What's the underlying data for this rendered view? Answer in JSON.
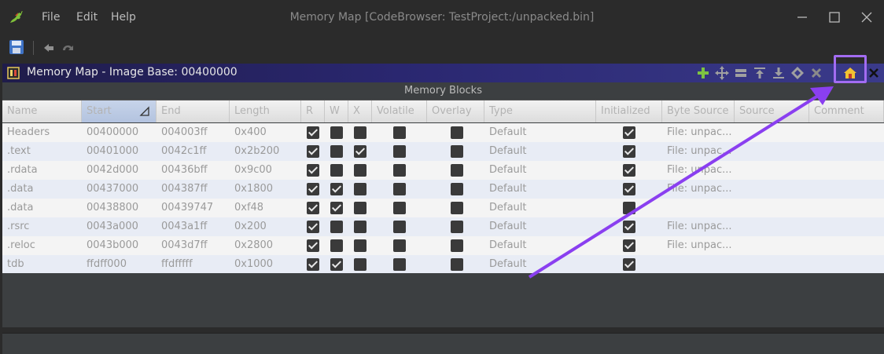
{
  "window": {
    "title": "Memory Map [CodeBrowser: TestProject:/unpacked.bin]",
    "menu": [
      "File",
      "Edit",
      "Help"
    ]
  },
  "toolbar": {
    "icons": [
      "save-icon",
      "undo-icon",
      "redo-icon"
    ]
  },
  "panel": {
    "title": "Memory Map - Image Base: 00400000",
    "actions": [
      "add-block-icon",
      "move-block-icon",
      "split-block-icon",
      "expand-up-icon",
      "expand-down-icon",
      "merge-blocks-icon",
      "delete-block-icon",
      "set-image-base-icon",
      "close-icon"
    ],
    "highlighted_action": "set-image-base-icon"
  },
  "table": {
    "title": "Memory Blocks",
    "columns": [
      "Name",
      "Start",
      "End",
      "Length",
      "R",
      "W",
      "X",
      "Volatile",
      "Overlay",
      "Type",
      "Initialized",
      "Byte Source",
      "Source",
      "Comment"
    ],
    "rows": [
      {
        "name": "Headers",
        "start": "00400000",
        "end": "004003ff",
        "length": "0x400",
        "r": true,
        "w": false,
        "x": false,
        "volatile": false,
        "overlay": false,
        "type": "Default",
        "initialized": true,
        "byte_source": "File: unpac...",
        "source": "",
        "comment": ""
      },
      {
        "name": ".text",
        "start": "00401000",
        "end": "0042c1ff",
        "length": "0x2b200",
        "r": true,
        "w": false,
        "x": true,
        "volatile": false,
        "overlay": false,
        "type": "Default",
        "initialized": true,
        "byte_source": "File: unpac...",
        "source": "",
        "comment": ""
      },
      {
        "name": ".rdata",
        "start": "0042d000",
        "end": "00436bff",
        "length": "0x9c00",
        "r": true,
        "w": false,
        "x": false,
        "volatile": false,
        "overlay": false,
        "type": "Default",
        "initialized": true,
        "byte_source": "File: unpac...",
        "source": "",
        "comment": ""
      },
      {
        "name": ".data",
        "start": "00437000",
        "end": "004387ff",
        "length": "0x1800",
        "r": true,
        "w": true,
        "x": false,
        "volatile": false,
        "overlay": false,
        "type": "Default",
        "initialized": true,
        "byte_source": "File: unpac...",
        "source": "",
        "comment": ""
      },
      {
        "name": ".data",
        "start": "00438800",
        "end": "00439747",
        "length": "0xf48",
        "r": true,
        "w": true,
        "x": false,
        "volatile": false,
        "overlay": false,
        "type": "Default",
        "initialized": false,
        "byte_source": "",
        "source": "",
        "comment": ""
      },
      {
        "name": ".rsrc",
        "start": "0043a000",
        "end": "0043a1ff",
        "length": "0x200",
        "r": true,
        "w": false,
        "x": false,
        "volatile": false,
        "overlay": false,
        "type": "Default",
        "initialized": true,
        "byte_source": "File: unpac...",
        "source": "",
        "comment": ""
      },
      {
        "name": ".reloc",
        "start": "0043b000",
        "end": "0043d7ff",
        "length": "0x2800",
        "r": true,
        "w": false,
        "x": false,
        "volatile": false,
        "overlay": false,
        "type": "Default",
        "initialized": true,
        "byte_source": "File: unpac...",
        "source": "",
        "comment": ""
      },
      {
        "name": "tdb",
        "start": "ffdff000",
        "end": "ffdfffff",
        "length": "0x1000",
        "r": true,
        "w": true,
        "x": false,
        "volatile": false,
        "overlay": false,
        "type": "Default",
        "initialized": true,
        "byte_source": "",
        "source": "",
        "comment": ""
      }
    ]
  },
  "annotation": {
    "color": "#8a3ff0",
    "highlight_color": "#a26cf2"
  }
}
